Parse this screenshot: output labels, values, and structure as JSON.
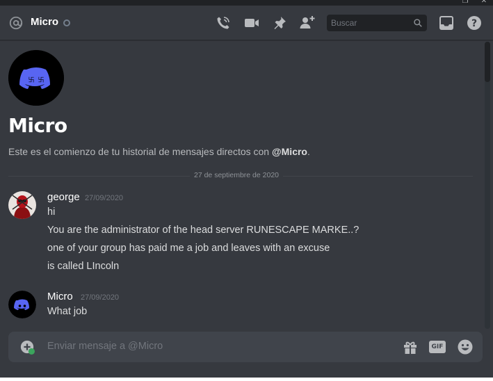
{
  "window": {
    "restore_glyph": "❐",
    "close_glyph": "✕"
  },
  "header": {
    "channel_name": "Micro",
    "search_placeholder": "Buscar",
    "icons": [
      "at-icon",
      "phone-call-icon",
      "video-icon",
      "pin-icon",
      "add-friend-icon",
      "search-icon",
      "inbox-icon",
      "help-icon"
    ],
    "help_glyph": "?"
  },
  "intro": {
    "name": "Micro",
    "description_prefix": "Este es el comienzo de tu historial de mensajes directos con ",
    "description_mention": "@Micro",
    "description_suffix": "."
  },
  "date_divider": "27 de septiembre de 2020",
  "messages": [
    {
      "author": "george",
      "timestamp": "27/09/2020",
      "lines": [
        "hi",
        "You are the administrator of the head server RUNESCAPE MARKE..?",
        "one of your group has paid me a job and leaves with an excuse",
        "is called LIncoln"
      ]
    },
    {
      "author": "Micro",
      "timestamp": "27/09/2020",
      "lines": [
        "What job"
      ]
    }
  ],
  "composer": {
    "placeholder": "Enviar mensaje a @Micro",
    "gif_label": "GIF"
  },
  "colors": {
    "background": "#36393f",
    "blurple": "#5865f2",
    "composer": "#40444b",
    "muted": "#72767d"
  }
}
